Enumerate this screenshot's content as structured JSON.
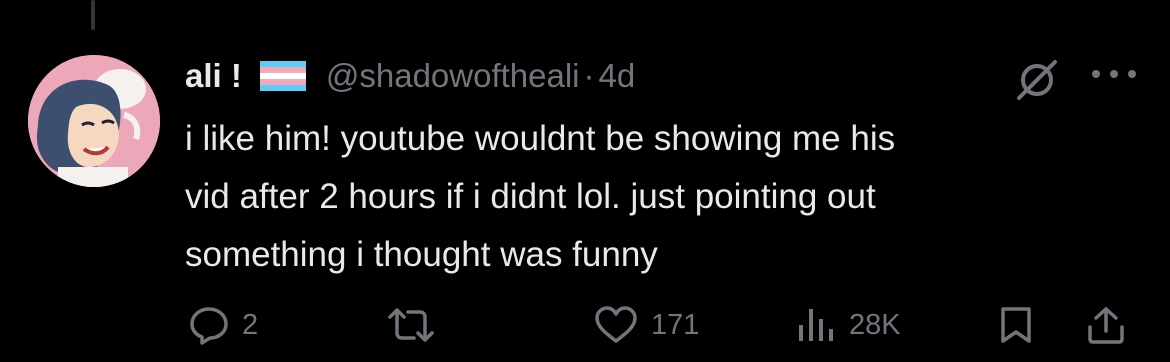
{
  "author": {
    "display_name": "ali !",
    "handle": "@shadowoftheali",
    "separator": "·",
    "time_ago": "4d",
    "flag": "transgender-flag"
  },
  "tweet": {
    "lines": [
      "i like him! youtube wouldnt be showing me his",
      "vid after 2 hours if i didnt lol. just pointing out",
      "something i thought was funny"
    ]
  },
  "actions": {
    "replies": "2",
    "likes": "171",
    "views": "28K"
  },
  "colors": {
    "background": "#000000",
    "text": "#e7e9ea",
    "muted": "#71767b"
  }
}
